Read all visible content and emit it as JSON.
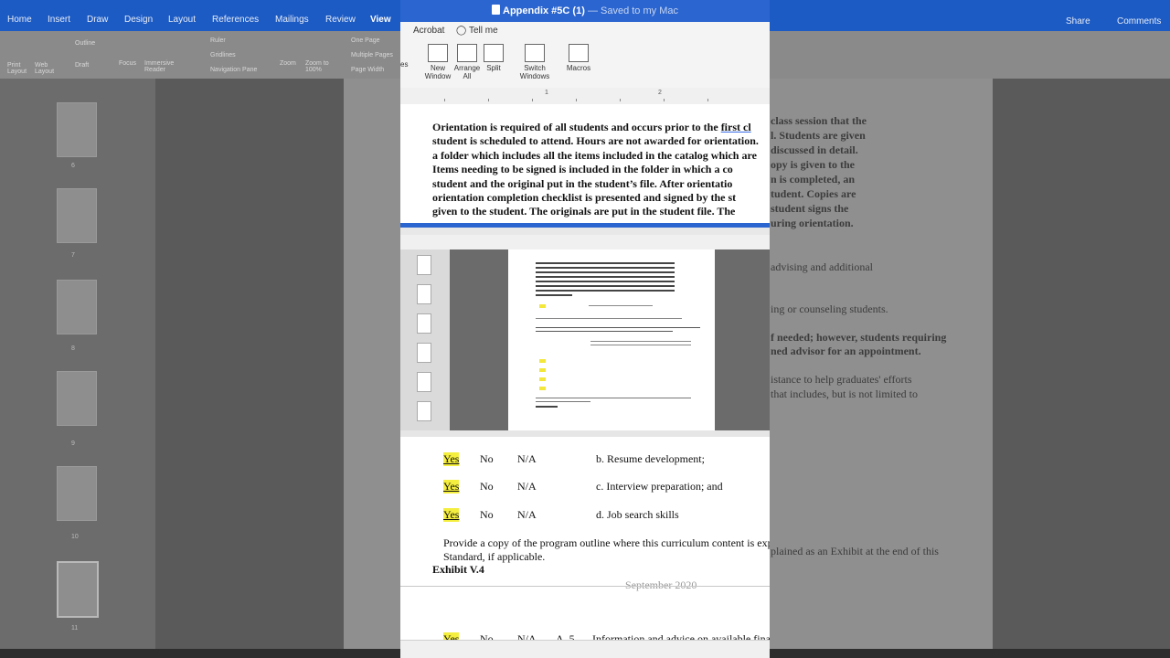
{
  "background_word": {
    "tabs": [
      "Home",
      "Insert",
      "Draw",
      "Design",
      "Layout",
      "References",
      "Mailings",
      "Review",
      "View"
    ],
    "active_tab": "View",
    "share_label": "Share",
    "comments_label": "Comments",
    "ribbon": {
      "print_layout": "Print Layout",
      "web_layout": "Web Layout",
      "outline": "Outline",
      "draft": "Draft",
      "focus": "Focus",
      "immersive_reader": "Immersive Reader",
      "ruler": "Ruler",
      "gridlines": "Gridlines",
      "navigation_pane": "Navigation Pane",
      "zoom": "Zoom",
      "zoom_100": "Zoom to 100%",
      "one_page": "One Page",
      "multiple_pages": "Multiple Pages",
      "page_width": "Page Width"
    },
    "thumb_numbers": [
      "6",
      "7",
      "8",
      "9",
      "10",
      "11"
    ],
    "right_text": [
      "class session that the",
      "l. Students are given",
      "discussed in detail.",
      "opy is given to the",
      "n is completed, an",
      "tudent. Copies are",
      "student signs the",
      "uring orientation.",
      "advising and additional",
      "ing or counseling students.",
      "f needed; however, students requiring",
      "ned advisor for an appointment.",
      "istance to help graduates' efforts",
      "that includes, but is not limited to",
      "plained as an Exhibit at the end of this"
    ]
  },
  "window": {
    "title": "Appendix #5C (1)",
    "saved_status": "— Saved to my Mac",
    "menu_acrobat": "Acrobat",
    "menu_tell_me": "Tell me",
    "ribbon_partial": "es",
    "ribbon_buttons": {
      "new_window": "New Window",
      "arrange_all": "Arrange All",
      "split": "Split",
      "switch_windows": "Switch Windows",
      "macros": "Macros"
    },
    "ruler_numbers": [
      "1",
      "2"
    ]
  },
  "document": {
    "orientation_lines": [
      "Orientation is required of all students and occurs prior to the ",
      "student  is scheduled to attend. Hours are not awarded for orientation.",
      "a folder which  includes all the items included in the catalog which are",
      "Items needing to be   signed is included in the folder in which a co",
      "student and the original put in   the student’s file.  After orientatio",
      "orientation completion checklist is  presented and signed by the st",
      "given to the student.  The  originals  are   put in the student file.  The"
    ],
    "first_class_word": "first cl",
    "rows": [
      {
        "yes": "Yes",
        "no": "No",
        "na": "N/A",
        "item": "b. Resume development;"
      },
      {
        "yes": "Yes",
        "no": "No",
        "na": "N/A",
        "item": "c. Interview preparation; and"
      },
      {
        "yes": "Yes",
        "no": "No",
        "na": "N/A",
        "item": "d. Job search skills"
      }
    ],
    "provide_line1": "Provide a copy of the program outline where this curriculum content is exp",
    "provide_line2": "Standard, if applicable.",
    "exhibit": "Exhibit V.4",
    "ghost_date": "September 2020",
    "next_row": {
      "yes": "Yes",
      "no": "No",
      "na": "N/A",
      "num": "A. 5.",
      "item": "Information and advice on available finan"
    }
  },
  "colors": {
    "title_blue": "#2b65cf",
    "highlight_yellow": "#f4ee3e"
  }
}
